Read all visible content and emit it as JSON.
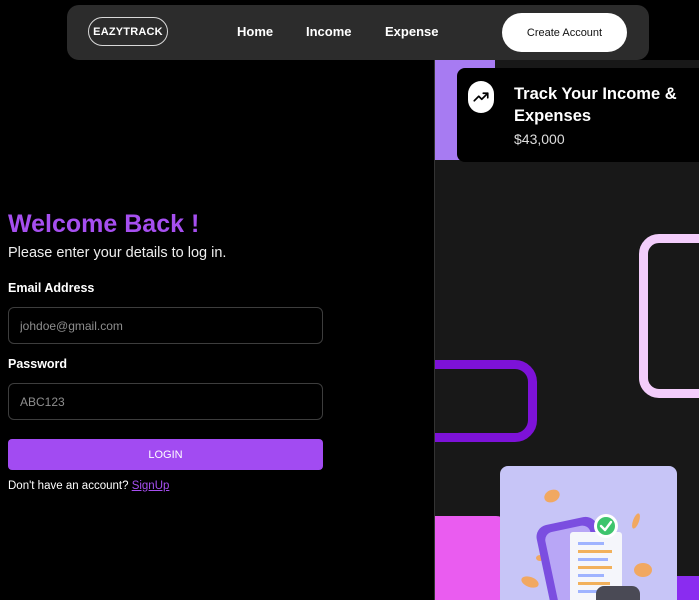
{
  "navbar": {
    "logo": "EAZYTRACK",
    "links": [
      "Home",
      "Income",
      "Expense"
    ],
    "cta": "Create Account"
  },
  "login": {
    "title": "Welcome Back !",
    "subtitle": "Please enter your details to log in.",
    "email_label": "Email Address",
    "email_placeholder": "johdoe@gmail.com",
    "password_label": "Password",
    "password_placeholder": "ABC123",
    "submit_label": "LOGIN",
    "signup_prompt": "Don't have an account?",
    "signup_link": "SignUp"
  },
  "stat_card": {
    "icon": "trending-up-icon",
    "title": "Track Your Income & Expenses",
    "amount": "$43,000"
  },
  "colors": {
    "accent": "#a64ff0",
    "button": "#a24bf2",
    "panel": "#181818",
    "ring_pink": "#f3cdfb",
    "ring_violet": "#7d12d8",
    "illustration_bg": "#c7c5f7"
  },
  "illustration": {
    "icon": "phone-receipt-coins-illustration"
  }
}
